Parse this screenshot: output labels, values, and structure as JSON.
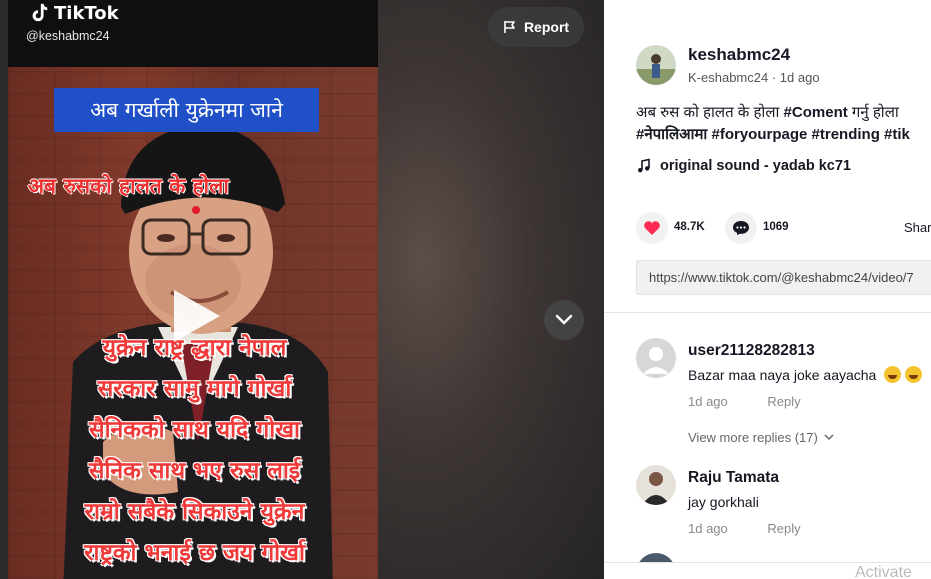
{
  "app": {
    "logo_text": "TikTok",
    "video_handle": "@keshabmc24",
    "report_label": "Report"
  },
  "video": {
    "banner_text": "अब गर्खाली युक्रेनमा जाने",
    "red_caption": "अब रुसको हालत के होला",
    "overlay_lines": [
      "युक्रेन राष्ट्र द्धारा नेपाल",
      "सरकार सामु मागे गोर्खा",
      "सैनिकको साथ  यदि गोखा",
      "सैनिक  साथ भए रुस लाई",
      "राम्रो सबैके सिकाउने युक्रेन",
      "राष्ट्रको भनाई छ जय गोर्खा"
    ]
  },
  "post": {
    "author_username": "keshabmc24",
    "author_nickname": "K-eshabmc24",
    "posted_ago": "1d ago",
    "description_text": "अब रुस को हालत के होला ",
    "description_tag1": "#Coment",
    "description_mid": " गर्नु होला ",
    "hashtags": [
      "#नेपालिआमा",
      "#foryourpage",
      "#trending",
      "#tik"
    ],
    "music": "original sound - yadab kc71",
    "likes": "48.7K",
    "comments_count": "1069",
    "share_label": "Shar",
    "link": "https://www.tiktok.com/@keshabmc24/video/7"
  },
  "comments": [
    {
      "user": "user21128282813 3",
      "display": "user21128282813",
      "text": "Bazar maa naya joke aayacha",
      "time": "1d ago",
      "reply": "Reply",
      "view_more": "View more replies (17)"
    },
    {
      "user": "Raju Tamata",
      "text": "jay gorkhali",
      "time": "1d ago",
      "reply": "Reply"
    }
  ],
  "system": {
    "watermark": "Activate"
  },
  "colors": {
    "like_accent": "#fe2c55",
    "banner_blue": "#2050c8",
    "caption_red": "#ee3030"
  }
}
